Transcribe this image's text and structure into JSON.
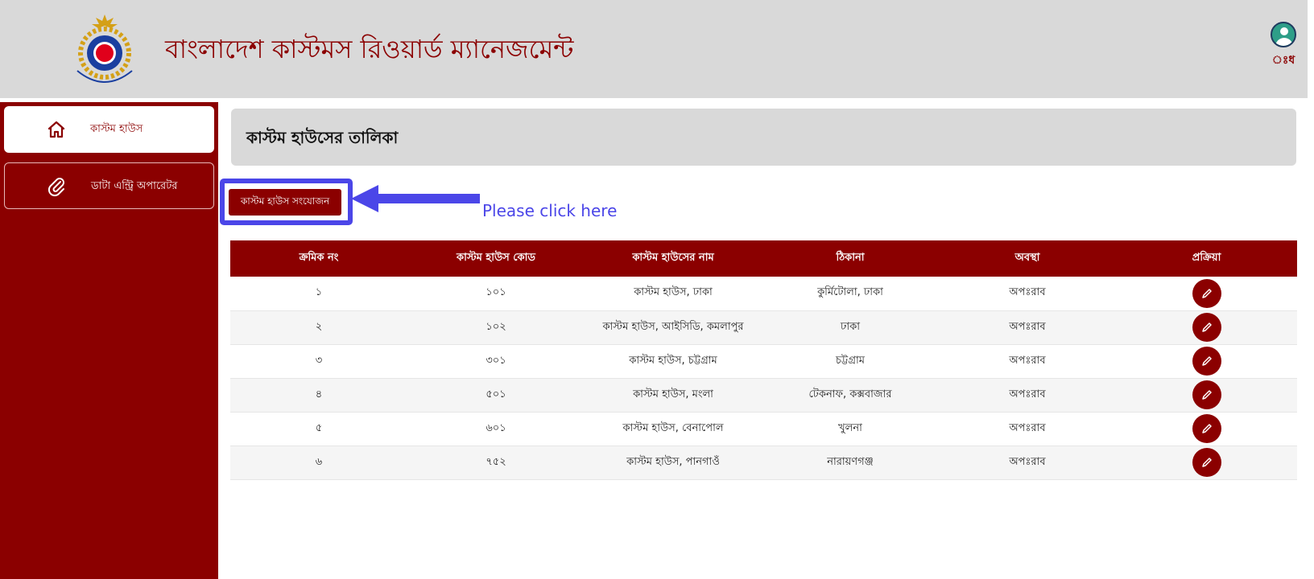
{
  "header": {
    "app_title": "বাংলাদেশ কাস্টমস রিওয়ার্ড ম্যানেজমেন্ট",
    "logo_text": "BANGLADESH CUSTOMS & VAT",
    "user": {
      "name": "ঃধ",
      "icon": "user-avatar-icon"
    }
  },
  "sidebar": {
    "items": [
      {
        "label": "কাস্টম হাউস",
        "icon": "home-icon",
        "active": true
      },
      {
        "label": "ডাটা এন্ট্রি অপারেটর",
        "icon": "paperclip-icon",
        "active": false
      }
    ]
  },
  "main": {
    "page_title": "কাস্টম হাউসের তালিকা",
    "add_button_label": "কাস্টম হাউস সংযোজন",
    "hint_text": "Please click here"
  },
  "table": {
    "columns": [
      "ক্রমিক নং",
      "কাস্টম হাউস কোড",
      "কাস্টম হাউসের নাম",
      "ঠিকানা",
      "অবস্থা",
      "প্রক্রিয়া"
    ],
    "rows": [
      {
        "serial": "১",
        "code": "১০১",
        "name": "কাস্টম হাউস, ঢাকা",
        "address": "কুর্মিটোলা, ঢাকা",
        "status": "অপঃরাব"
      },
      {
        "serial": "২",
        "code": "১০২",
        "name": "কাস্টম হাউস, আইসিডি, কমলাপুর",
        "address": "ঢাকা",
        "status": "অপঃরাব"
      },
      {
        "serial": "৩",
        "code": "৩০১",
        "name": "কাস্টম হাউস, চট্টগ্রাম",
        "address": "চট্টগ্রাম",
        "status": "অপঃরাব"
      },
      {
        "serial": "৪",
        "code": "৫০১",
        "name": "কাস্টম হাউস, মংলা",
        "address": "টেকনাফ, কক্সবাজার",
        "status": "অপঃরাব"
      },
      {
        "serial": "৫",
        "code": "৬০১",
        "name": "কাস্টম হাউস, বেনাপোল",
        "address": "খুলনা",
        "status": "অপঃরাব"
      },
      {
        "serial": "৬",
        "code": "৭৫২",
        "name": "কাস্টম হাউস, পানগাওঁ",
        "address": "নারায়ণগঞ্জ",
        "status": "অপঃরাব"
      }
    ],
    "action_icon": "pencil-icon"
  },
  "colors": {
    "brand": "#8b0000",
    "header_bg": "#d9d9d9",
    "annotation": "#4b46e8"
  }
}
